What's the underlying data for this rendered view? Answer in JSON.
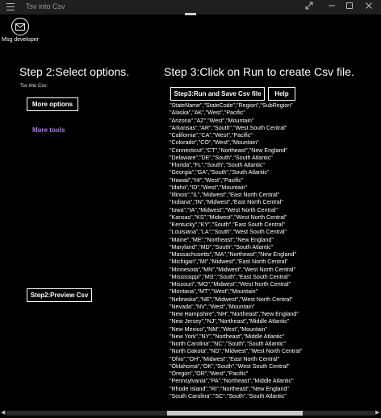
{
  "window": {
    "title": "Tsv into Csv",
    "icons": {
      "menu": "hamburger-icon",
      "fullscreen": "expand-diagonal-icon",
      "minimize": "minimize-icon",
      "maximize": "maximize-icon",
      "close": "close-icon"
    }
  },
  "message_developer": {
    "label": "Msg developer",
    "icon": "mail-icon"
  },
  "step2": {
    "title": "Step 2:Select options.",
    "input_label": "Tsv into Csv:",
    "more_options_label": "More options",
    "more_tools_label": "More tools",
    "preview_label": "Step2:Preview Csv",
    "link_color": "#a37ce8"
  },
  "step3": {
    "title": "Step 3:Click on Run to create Csv file.",
    "run_label": "Step3:Run and Save Csv file",
    "help_label": "Help"
  },
  "csv_lines": [
    "\"StateName\",\"StateCode\",\"Region\",\"SubRegion\"",
    "\"Alaska\",\"AK\",\"West\",\"Pacific\"",
    "\"Arizona\",\"AZ\",\"West\",\"Mountain\"",
    "\"Arkansas\",\"AR\",\"South\",\"West South Central\"",
    "\"California\",\"CA\",\"West\",\"Pacific\"",
    "\"Colorado\",\"CO\",\"West\",\"Mountain\"",
    "\"Connecticut\",\"CT\",\"Northeast\",\"New England\"",
    "\"Delaware\",\"DE\",\"South\",\"South Atlantic\"",
    "\"Florida\",\"FL\",\"South\",\"South Atlantic\"",
    "\"Georgia\",\"GA\",\"South\",\"South Atlantic\"",
    "\"Hawaii\",\"HI\",\"West\",\"Pacific\"",
    "\"Idaho\",\"ID\",\"West\",\"Mountain\"",
    "\"Illinois\",\"IL\",\"Midwest\",\"East North Central\"",
    "\"Indiana\",\"IN\",\"Midwest\",\"East North Central\"",
    "\"Iowa\",\"IA\",\"Midwest\",\"West North Central\"",
    "\"Kansas\",\"KS\",\"Midwest\",\"West North Central\"",
    "\"Kentucky\",\"KY\",\"South\",\"East South Central\"",
    "\"Louisiana\",\"LA\",\"South\",\"West South Central\"",
    "\"Maine\",\"ME\",\"Northeast\",\"New England\"",
    "\"Maryland\",\"MD\",\"South\",\"South Atlantic\"",
    "\"Massachusetts\",\"MA\",\"Northeast\",\"New England\"",
    "\"Michigan\",\"MI\",\"Midwest\",\"East North Central\"",
    "\"Minnesota\",\"MN\",\"Midwest\",\"West North Central\"",
    "\"Mississippi\",\"MS\",\"South\",\"East South Central\"",
    "\"Missouri\",\"MO\",\"Midwest\",\"West North Central\"",
    "\"Montana\",\"MT\",\"West\",\"Mountain\"",
    "\"Nebraska\",\"NE\",\"Midwest\",\"West North Central\"",
    "\"Nevada\",\"NV\",\"West\",\"Mountain\"",
    "\"New Hampshire\",\"NH\",\"Northeast\",\"New England\"",
    "\"New Jersey\",\"NJ\",\"Northeast\",\"Middle Atlantic\"",
    "\"New Mexico\",\"NM\",\"West\",\"Mountain\"",
    "\"New York\",\"NY\",\"Northeast\",\"Middle Atlantic\"",
    "\"North Carolina\",\"NC\",\"South\",\"South Atlantic\"",
    "\"North Dakota\",\"ND\",\"Midwest\",\"West North Central\"",
    "\"Ohio\",\"OH\",\"Midwest\",\"East North Central\"",
    "\"Oklahoma\",\"OK\",\"South\",\"West South Central\"",
    "\"Oregon\",\"OR\",\"West\",\"Pacific\"",
    "\"Pennsylvania\",\"PA\",\"Northeast\",\"Middle Atlantic\"",
    "\"Rhode Island\",\"RI\",\"Northeast\",\"New England\"",
    "\"South Carolina\",\"SC\",\"South\",\"South Atlantic\""
  ]
}
